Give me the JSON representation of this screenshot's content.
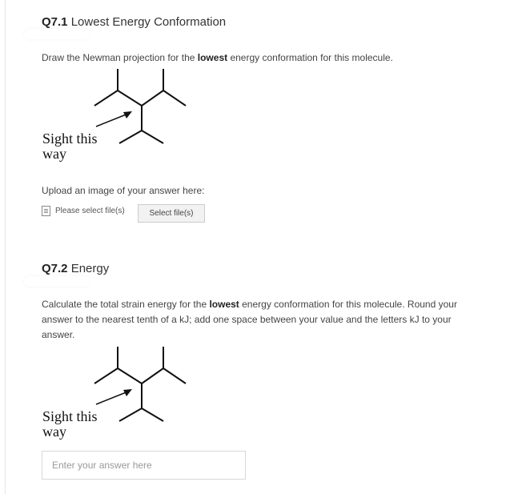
{
  "q1": {
    "number": "Q7.1",
    "title": "Lowest Energy Conformation",
    "prompt_before": "Draw the Newman projection for the ",
    "prompt_bold": "lowest",
    "prompt_after": " energy conformation for this molecule.",
    "sight_line1": "Sight this",
    "sight_line2": "way",
    "upload_label": "Upload an image of your answer here:",
    "file_text": "Please select file(s)",
    "select_button": "Select file(s)"
  },
  "q2": {
    "number": "Q7.2",
    "title": "Energy",
    "prompt_before": "Calculate the total strain energy for the ",
    "prompt_bold": "lowest",
    "prompt_after": " energy conformation for this molecule.  Round your answer to the nearest tenth of a kJ; add one space between your value and the letters kJ to your answer.",
    "sight_line1": "Sight this",
    "sight_line2": "way",
    "answer_placeholder": "Enter your answer here"
  }
}
